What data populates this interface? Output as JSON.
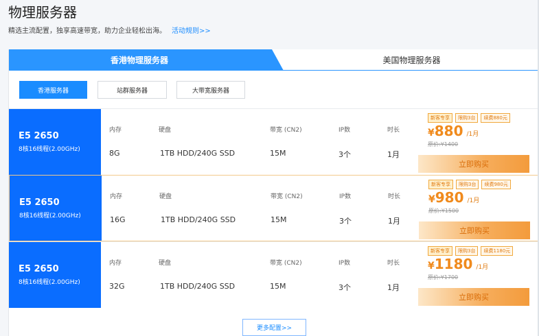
{
  "page": {
    "title": "物理服务器",
    "subtitle": "精选主流配置，独享高速带宽，助力企业轻松出海。",
    "rules_link": "活动规则>>"
  },
  "region_tabs": [
    {
      "label": "香港物理服务器",
      "active": true
    },
    {
      "label": "美国物理服务器",
      "active": false
    }
  ],
  "sub_tabs": [
    {
      "label": "香港服务器",
      "active": true
    },
    {
      "label": "站群服务器",
      "active": false
    },
    {
      "label": "大带宽服务器",
      "active": false
    }
  ],
  "columns": {
    "memory": "内存",
    "disk": "硬盘",
    "bandwidth": "带宽 (CN2)",
    "ip": "IP数",
    "duration": "时长"
  },
  "products": [
    {
      "model": "E5 2650",
      "spec": "8核16线程(2.00GHz)",
      "memory": "8G",
      "disk": "1TB HDD/240G SSD",
      "bandwidth": "15M",
      "ip": "3个",
      "duration": "1月",
      "tags": [
        "新客专享",
        "限购3台",
        "续费880元"
      ],
      "currency": "¥",
      "price": "880",
      "unit": "/1月",
      "original": "原价:¥1400",
      "buy_label": "立即购买"
    },
    {
      "model": "E5 2650",
      "spec": "8核16线程(2.00GHz)",
      "memory": "16G",
      "disk": "1TB HDD/240G SSD",
      "bandwidth": "15M",
      "ip": "3个",
      "duration": "1月",
      "tags": [
        "新客专享",
        "限购3台",
        "续费980元"
      ],
      "currency": "¥",
      "price": "980",
      "unit": "/1月",
      "original": "原价:¥1500",
      "buy_label": "立即购买"
    },
    {
      "model": "E5 2650",
      "spec": "8核16线程(2.00GHz)",
      "memory": "32G",
      "disk": "1TB HDD/240G SSD",
      "bandwidth": "15M",
      "ip": "3个",
      "duration": "1月",
      "tags": [
        "新客专享",
        "限购3台",
        "续费1180元"
      ],
      "currency": "¥",
      "price": "1180",
      "unit": "/1月",
      "original": "原价:¥1700",
      "buy_label": "立即购买"
    }
  ],
  "more_label": "更多配置>>",
  "colors": {
    "primary": "#1a8cff",
    "cpu_block": "#0a6dff",
    "price": "#f08a1c"
  }
}
